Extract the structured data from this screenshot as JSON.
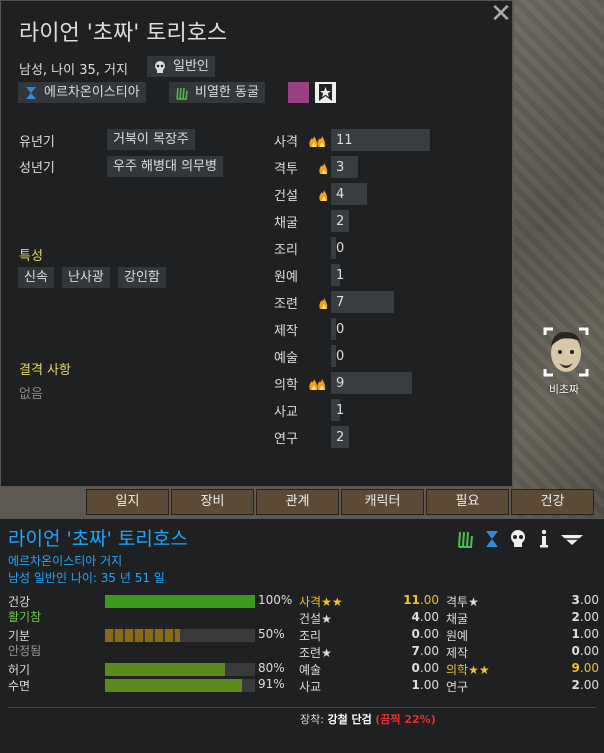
{
  "dialog": {
    "title": "라이언 '초짜' 토리호스",
    "subtitle": "남성, 나이 35, 거지",
    "chips": {
      "role": "일반인",
      "faction": "에르차온이스티아",
      "ideo": "비열한 동굴"
    },
    "close_label": "✕"
  },
  "backstory": {
    "childhood_label": "유년기",
    "childhood_value": "거북이 목장주",
    "adulthood_label": "성년기",
    "adulthood_value": "우주 해병대 의무병"
  },
  "traits": {
    "header": "특성",
    "items": [
      "신속",
      "난사광",
      "강인함"
    ]
  },
  "incapable": {
    "header": "결격 사항",
    "value": "없음"
  },
  "skills": [
    {
      "name": "사격",
      "level": 11,
      "passion": "major"
    },
    {
      "name": "격투",
      "level": 3,
      "passion": "minor"
    },
    {
      "name": "건설",
      "level": 4,
      "passion": "minor"
    },
    {
      "name": "채굴",
      "level": 2,
      "passion": "none"
    },
    {
      "name": "조리",
      "level": 0,
      "passion": "none"
    },
    {
      "name": "원예",
      "level": 1,
      "passion": "none"
    },
    {
      "name": "조련",
      "level": 7,
      "passion": "minor"
    },
    {
      "name": "제작",
      "level": 0,
      "passion": "none"
    },
    {
      "name": "예술",
      "level": 0,
      "passion": "none"
    },
    {
      "name": "의학",
      "level": 9,
      "passion": "major"
    },
    {
      "name": "사교",
      "level": 1,
      "passion": "none"
    },
    {
      "name": "연구",
      "level": 2,
      "passion": "none"
    }
  ],
  "tabs": [
    "일지",
    "장비",
    "관계",
    "캐릭터",
    "필요",
    "건강"
  ],
  "map": {
    "pawn_label": "비초짜"
  },
  "inspect": {
    "name": "라이언 '초짜' 토리호스",
    "faction_line": "에르차온이스티아 거지",
    "info_line": "남성 일반인 나이: 35 년 51 일",
    "needs": [
      {
        "name": "건강",
        "pct": "100%",
        "fill": 1.0,
        "color": "#3d9a1e",
        "state": "활기참",
        "state_color": "#6ec94a"
      },
      {
        "name": "기분",
        "pct": "50%",
        "fill": 0.5,
        "color": "#8a6a17",
        "state": "안정됨",
        "state_color": "#999999"
      },
      {
        "name": "허기",
        "pct": "80%",
        "fill": 0.8,
        "color": "#5d8a1c",
        "state": "",
        "state_color": ""
      },
      {
        "name": "수면",
        "pct": "91%",
        "fill": 0.91,
        "color": "#5d8a1c",
        "state": "",
        "state_color": ""
      }
    ],
    "skills_col1": [
      {
        "name": "사격★★",
        "int": "11",
        "dec": ".00",
        "hl": true
      },
      {
        "name": "건설★",
        "int": "4",
        "dec": ".00",
        "hl": false
      },
      {
        "name": "조리",
        "int": "0",
        "dec": ".00",
        "hl": false
      },
      {
        "name": "조련★",
        "int": "7",
        "dec": ".00",
        "hl": false
      },
      {
        "name": "예술",
        "int": "0",
        "dec": ".00",
        "hl": false
      },
      {
        "name": "사교",
        "int": "1",
        "dec": ".00",
        "hl": false
      }
    ],
    "skills_col2": [
      {
        "name": "격투★",
        "int": "3",
        "dec": ".00",
        "hl": false
      },
      {
        "name": "채굴",
        "int": "2",
        "dec": ".00",
        "hl": false
      },
      {
        "name": "원예",
        "int": "1",
        "dec": ".00",
        "hl": false
      },
      {
        "name": "제작",
        "int": "0",
        "dec": ".00",
        "hl": false
      },
      {
        "name": "의학★★",
        "int": "9",
        "dec": ".00",
        "hl": true
      },
      {
        "name": "연구",
        "int": "2",
        "dec": ".00",
        "hl": false
      }
    ],
    "equip_label": "장착:",
    "equip_item": "강철 단검",
    "equip_quality": "(끔찍 22%)"
  }
}
